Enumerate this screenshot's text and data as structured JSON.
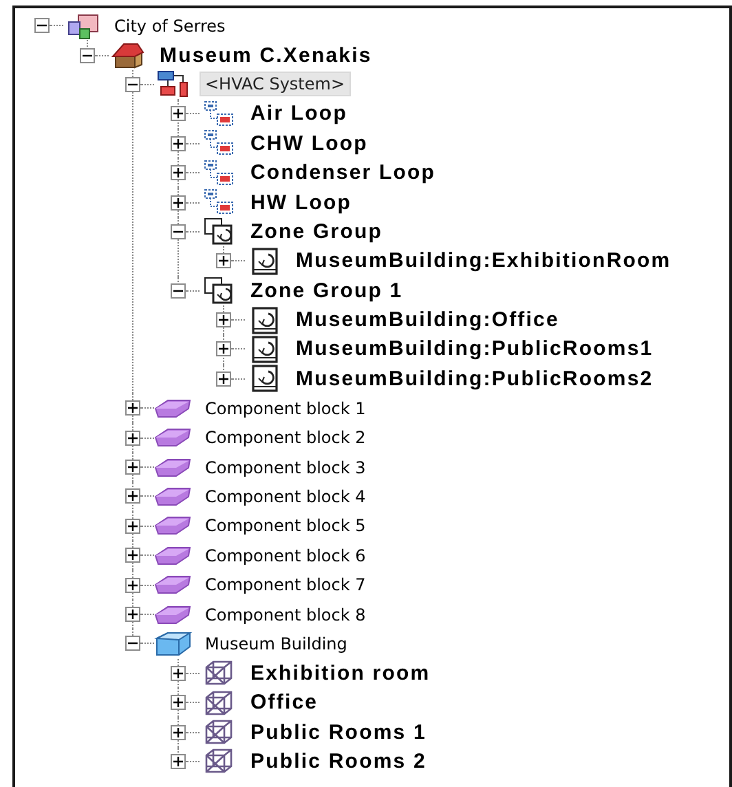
{
  "tree": [
    {
      "label": "City of Serres",
      "kind": "city",
      "bold": false,
      "expanded": true,
      "selected": false,
      "children": [
        {
          "label": "Museum C.Xenakis",
          "kind": "house",
          "bold": true,
          "expanded": true,
          "selected": false,
          "children": [
            {
              "label": "<HVAC System>",
              "kind": "hvac",
              "bold": false,
              "expanded": true,
              "selected": true,
              "children": [
                {
                  "label": "Air Loop",
                  "kind": "loop",
                  "bold": true,
                  "expanded": false,
                  "selected": false
                },
                {
                  "label": "CHW Loop",
                  "kind": "loop",
                  "bold": true,
                  "expanded": false,
                  "selected": false
                },
                {
                  "label": "Condenser Loop",
                  "kind": "loop",
                  "bold": true,
                  "expanded": false,
                  "selected": false
                },
                {
                  "label": "HW Loop",
                  "kind": "loop",
                  "bold": true,
                  "expanded": false,
                  "selected": false
                },
                {
                  "label": "Zone Group",
                  "kind": "zone-group",
                  "bold": true,
                  "expanded": true,
                  "selected": false,
                  "children": [
                    {
                      "label": "MuseumBuilding:ExhibitionRoom",
                      "kind": "zone",
                      "bold": true,
                      "expanded": false,
                      "selected": false
                    }
                  ]
                },
                {
                  "label": "Zone Group 1",
                  "kind": "zone-group",
                  "bold": true,
                  "expanded": true,
                  "selected": false,
                  "children": [
                    {
                      "label": "MuseumBuilding:Office",
                      "kind": "zone",
                      "bold": true,
                      "expanded": false,
                      "selected": false
                    },
                    {
                      "label": "MuseumBuilding:PublicRooms1",
                      "kind": "zone",
                      "bold": true,
                      "expanded": false,
                      "selected": false
                    },
                    {
                      "label": "MuseumBuilding:PublicRooms2",
                      "kind": "zone",
                      "bold": true,
                      "expanded": false,
                      "selected": false
                    }
                  ]
                }
              ]
            },
            {
              "label": "Component block 1",
              "kind": "component",
              "bold": false,
              "expanded": false,
              "selected": false
            },
            {
              "label": "Component block 2",
              "kind": "component",
              "bold": false,
              "expanded": false,
              "selected": false
            },
            {
              "label": "Component block 3",
              "kind": "component",
              "bold": false,
              "expanded": false,
              "selected": false
            },
            {
              "label": "Component block 4",
              "kind": "component",
              "bold": false,
              "expanded": false,
              "selected": false
            },
            {
              "label": "Component block 5",
              "kind": "component",
              "bold": false,
              "expanded": false,
              "selected": false
            },
            {
              "label": "Component block 6",
              "kind": "component",
              "bold": false,
              "expanded": false,
              "selected": false
            },
            {
              "label": "Component block 7",
              "kind": "component",
              "bold": false,
              "expanded": false,
              "selected": false
            },
            {
              "label": "Component block 8",
              "kind": "component",
              "bold": false,
              "expanded": false,
              "selected": false
            },
            {
              "label": "Museum Building",
              "kind": "building",
              "bold": false,
              "expanded": true,
              "selected": false,
              "children": [
                {
                  "label": "Exhibition room",
                  "kind": "room",
                  "bold": true,
                  "expanded": false,
                  "selected": false
                },
                {
                  "label": "Office",
                  "kind": "room",
                  "bold": true,
                  "expanded": false,
                  "selected": false
                },
                {
                  "label": "Public Rooms 1",
                  "kind": "room",
                  "bold": true,
                  "expanded": false,
                  "selected": false
                },
                {
                  "label": "Public Rooms 2",
                  "kind": "room",
                  "bold": true,
                  "expanded": false,
                  "selected": false
                }
              ]
            }
          ]
        }
      ]
    }
  ]
}
